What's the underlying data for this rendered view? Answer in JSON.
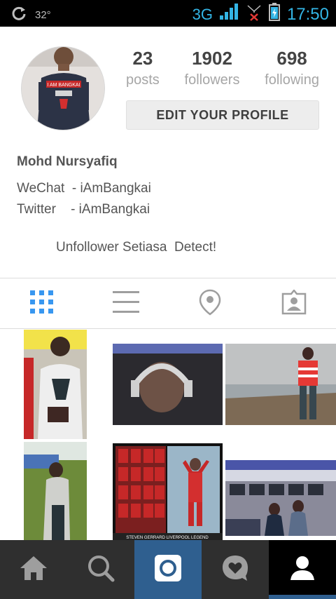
{
  "status_bar": {
    "temperature": "32°",
    "network": "3G",
    "time": "17:50"
  },
  "profile": {
    "stats": [
      {
        "value": "23",
        "label": "posts"
      },
      {
        "value": "1902",
        "label": "followers"
      },
      {
        "value": "698",
        "label": "following"
      }
    ],
    "edit_button_label": "EDIT YOUR PROFILE",
    "name": "Mohd Nursyafiq",
    "bio_lines": [
      "WeChat  - iAmBangkai",
      "Twitter    - iAmBangkai"
    ],
    "bio_tagline": "Unfollower Setiasa  Detect!",
    "avatar_shirt_text": "I AM BANGKAI"
  },
  "photo_captions": {
    "poster_caption": "STEVEN GERRARD LIVERPOOL LEGEND"
  },
  "colors": {
    "accent": "#3897f0",
    "nav_bg": "#2f2f2f",
    "camera_bg": "#2f5f8f",
    "status_blue": "#33b5e5"
  }
}
